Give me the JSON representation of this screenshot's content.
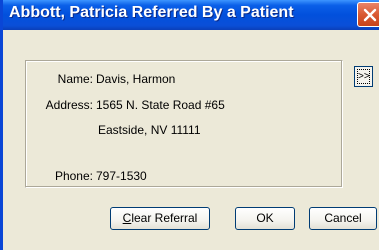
{
  "window": {
    "title": "Abbott, Patricia Referred By a Patient"
  },
  "referral": {
    "name_label": "Name:",
    "name_value": "Davis, Harmon",
    "address_label": "Address:",
    "address_line1": "1565 N. State Road #65",
    "address_line2": "Eastside, NV  11111",
    "phone_label": "Phone:",
    "phone_value": "797-1530"
  },
  "more_button": {
    "label": ">>",
    "icon": "more-icon"
  },
  "buttons": {
    "clear_referral_prefix": "C",
    "clear_referral_rest": "lear Referral",
    "ok": "OK",
    "cancel": "Cancel"
  }
}
